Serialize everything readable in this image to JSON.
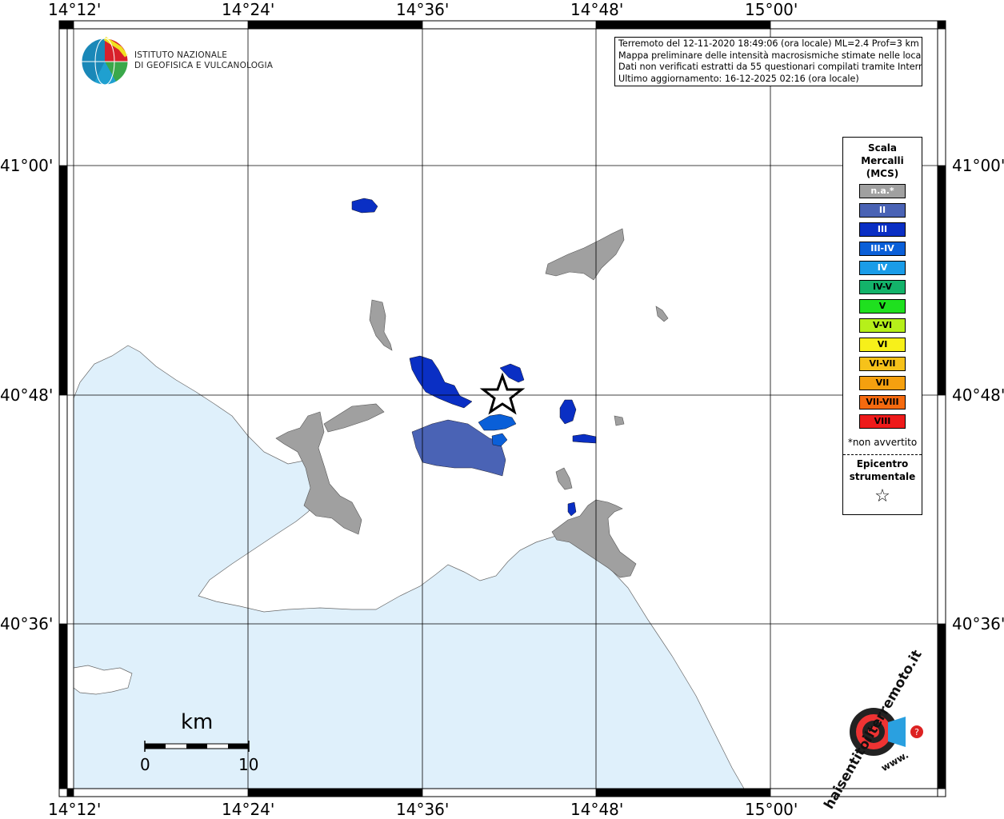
{
  "axis": {
    "top_labels": [
      "14°12'",
      "14°24'",
      "14°36'",
      "14°48'",
      "15°00'"
    ],
    "bottom_labels": [
      "14°12'",
      "14°24'",
      "14°36'",
      "14°48'",
      "15°00'"
    ],
    "left_labels": [
      "41°00'",
      "40°48'",
      "40°36'"
    ],
    "right_labels": [
      "41°00'",
      "40°48'",
      "40°36'"
    ]
  },
  "logo": {
    "line1": "ISTITUTO NAZIONALE",
    "line2": "DI GEOFISICA E VULCANOLOGIA"
  },
  "info": {
    "line1": "Terremoto del 12-11-2020 18:49:06 (ora locale) ML=2.4 Prof=3 km",
    "line2": "Mappa preliminare delle intensità macrosismiche stimate nelle località",
    "line3": "Dati non verificati estratti da 55 questionari compilati tramite Internet.",
    "line4": "Ultimo aggiornamento: 16-12-2025 02:16 (ora locale)"
  },
  "legend": {
    "title1": "Scala",
    "title2": "Mercalli",
    "title3": "(MCS)",
    "items": [
      {
        "label": "n.a.*",
        "color": "#a0a0a0",
        "text_color": "#ffffff"
      },
      {
        "label": "II",
        "color": "#4a63b5",
        "text_color": "#ffffff"
      },
      {
        "label": "III",
        "color": "#0a2fc4",
        "text_color": "#ffffff"
      },
      {
        "label": "III-IV",
        "color": "#0a5fd8",
        "text_color": "#ffffff"
      },
      {
        "label": "IV",
        "color": "#1a9ce8",
        "text_color": "#ffffff"
      },
      {
        "label": "IV-V",
        "color": "#13b36a",
        "text_color": "#000000"
      },
      {
        "label": "V",
        "color": "#1fe01f",
        "text_color": "#000000"
      },
      {
        "label": "V-VI",
        "color": "#b6f01a",
        "text_color": "#000000"
      },
      {
        "label": "VI",
        "color": "#f7f01a",
        "text_color": "#000000"
      },
      {
        "label": "VI-VII",
        "color": "#f6c21a",
        "text_color": "#000000"
      },
      {
        "label": "VII",
        "color": "#f5a00f",
        "text_color": "#000000"
      },
      {
        "label": "VII-VIII",
        "color": "#f56a0f",
        "text_color": "#000000"
      },
      {
        "label": "VIII",
        "color": "#ee1a1a",
        "text_color": "#000000"
      }
    ],
    "note": "*non avvertito",
    "epi1": "Epicentro",
    "epi2": "strumentale",
    "star": "☆"
  },
  "scale_bar": {
    "unit": "km",
    "start": "0",
    "end": "10"
  },
  "hs_logo": {
    "text": "haisentitoilterremoto.it",
    "www": "www."
  },
  "colors": {
    "sea": "#dff0fb",
    "land": "#ffffff",
    "na": "#a0a0a0",
    "II": "#4a63b5",
    "III": "#0a2fc4",
    "III-IV": "#0a5fd8"
  }
}
